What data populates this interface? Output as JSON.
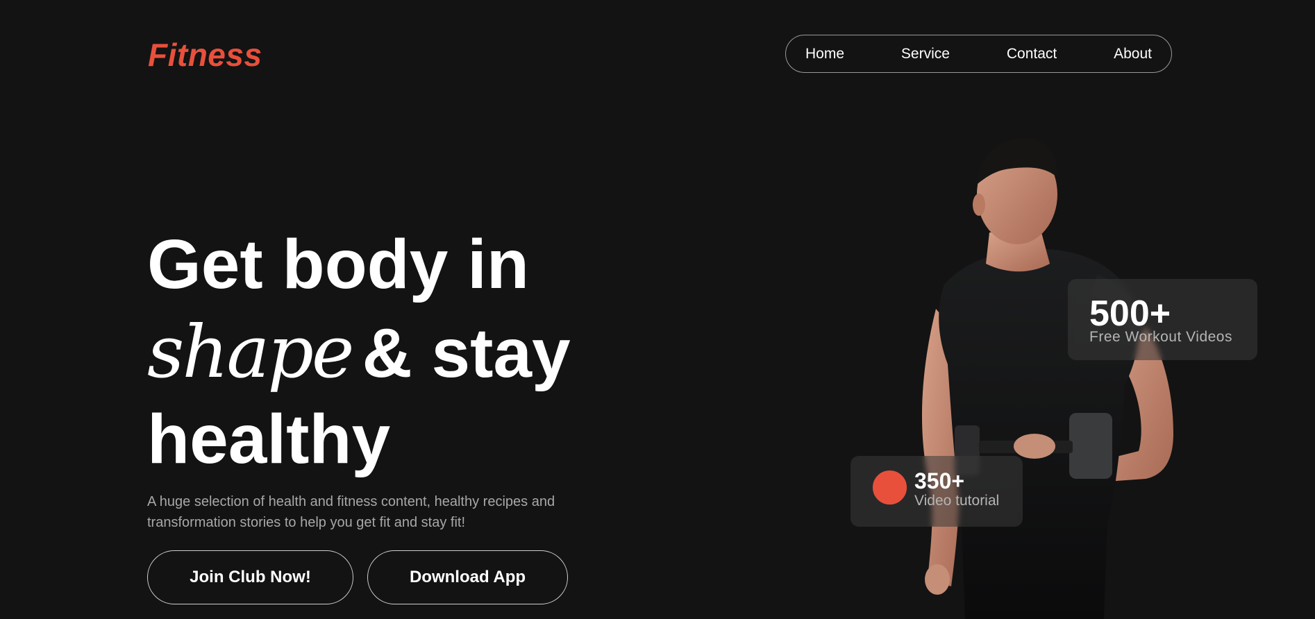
{
  "brand": {
    "logo_text": "Fitness",
    "accent_color": "#e8503c"
  },
  "nav": {
    "items": [
      {
        "label": "Home"
      },
      {
        "label": "Service"
      },
      {
        "label": "Contact"
      },
      {
        "label": "About"
      }
    ]
  },
  "hero": {
    "line1": "Get body in",
    "script_word": "shape",
    "line2_rest": "& stay",
    "line3": "healthy",
    "description": "A huge selection of health and fitness content, healthy recipes and transformation stories to help you get fit and stay fit!",
    "join_label": "Join Club Now!",
    "download_label": "Download App"
  },
  "stats": {
    "videos": {
      "value": "500+",
      "label": "Free Workout Videos"
    },
    "tutorials": {
      "value": "350+",
      "label": "Video tutorial"
    }
  },
  "figure": {
    "icon": "athlete-with-dumbbell-icon"
  }
}
